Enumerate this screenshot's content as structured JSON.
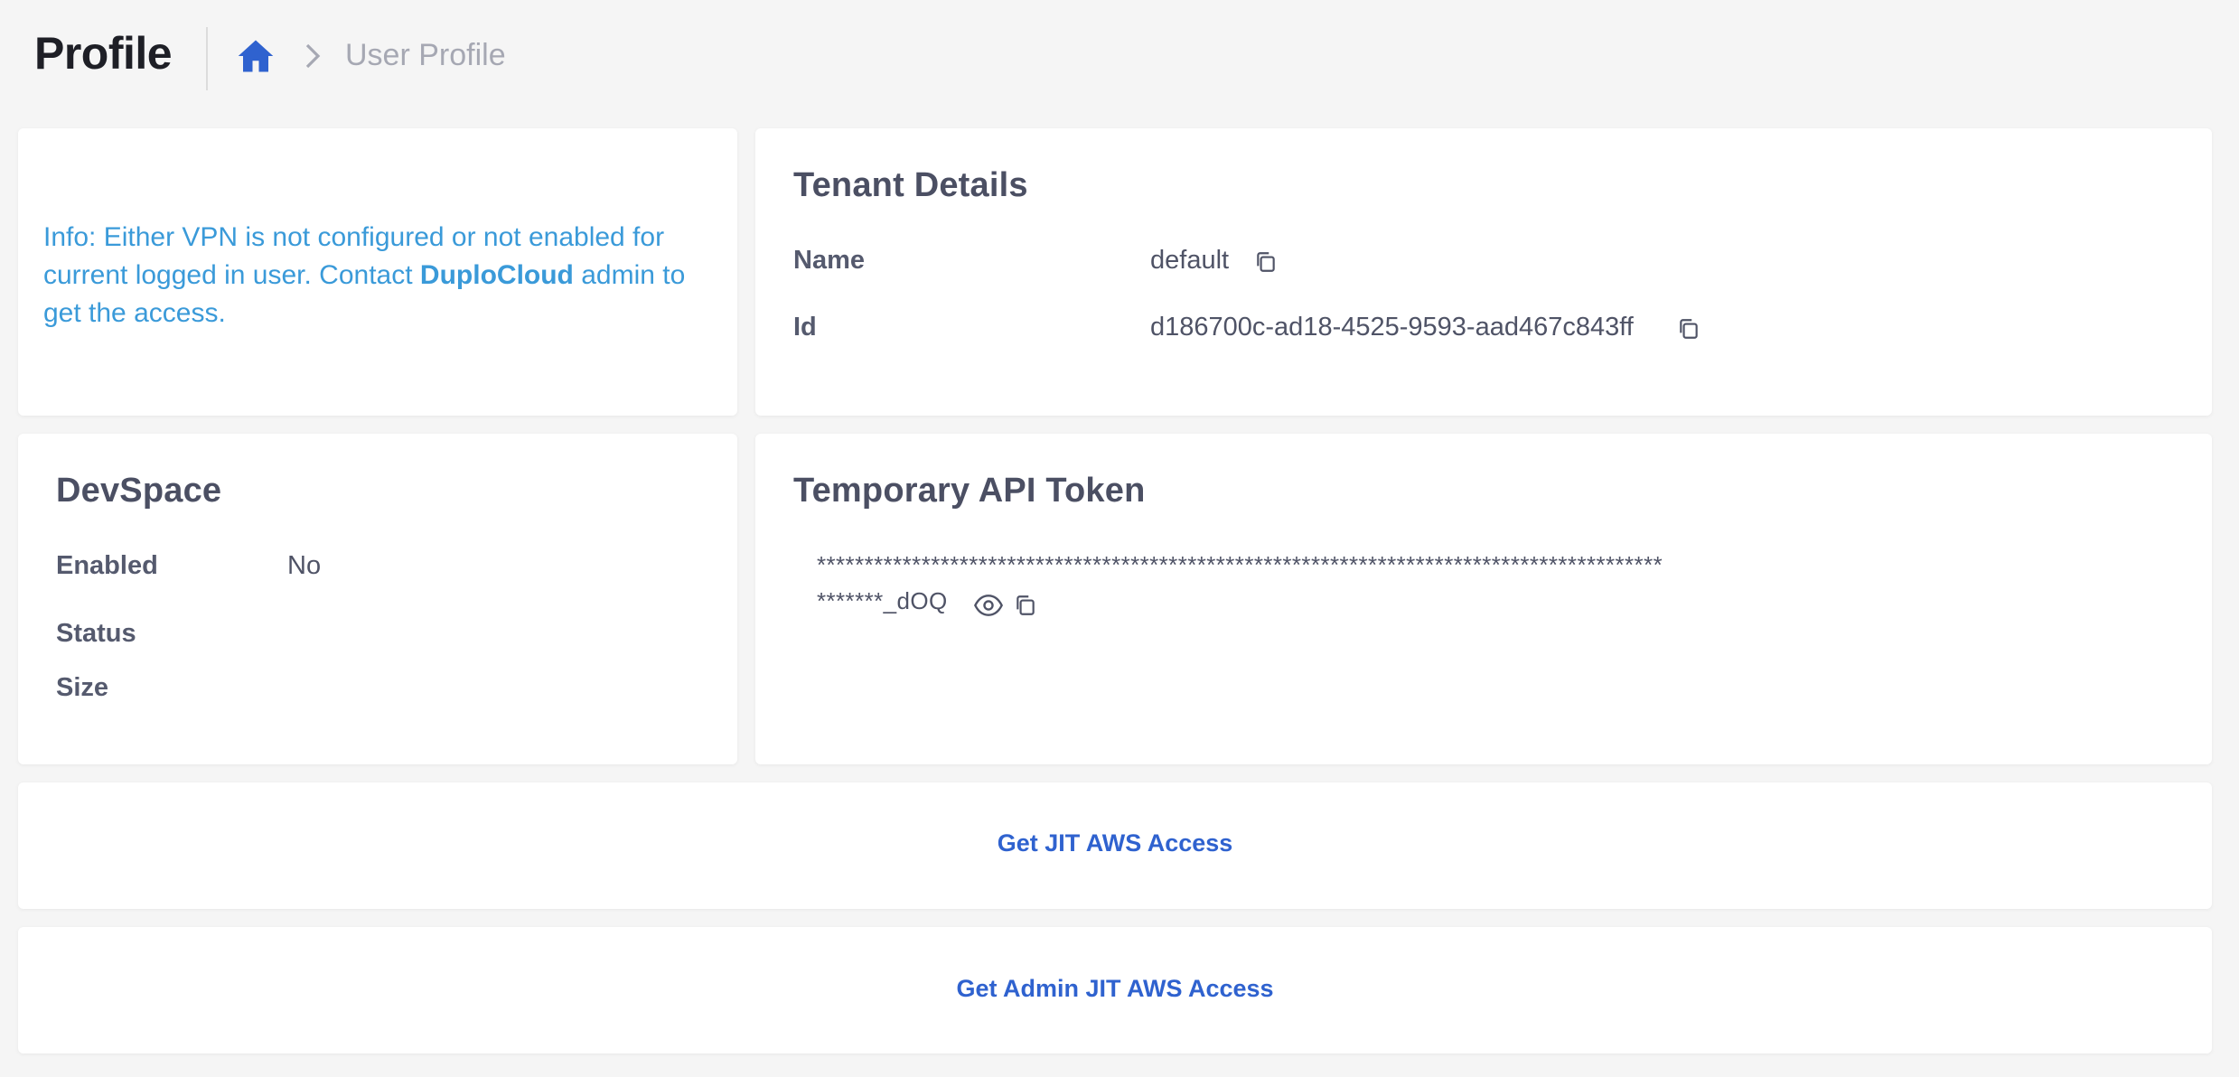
{
  "header": {
    "title": "Profile",
    "breadcrumb": {
      "home_icon": "home-icon",
      "separator_icon": "chevron-right-icon",
      "current": "User Profile"
    }
  },
  "vpn_info": {
    "text_before": "Info: Either VPN is not configured or not enabled for current logged in user. Contact ",
    "brand": "DuploCloud",
    "text_after": " admin to get the access."
  },
  "tenant_details": {
    "title": "Tenant Details",
    "rows": [
      {
        "label": "Name",
        "value": "default",
        "icon": "copy-icon"
      },
      {
        "label": "Id",
        "value": "d186700c-ad18-4525-9593-aad467c843ff",
        "icon": "copy-icon"
      }
    ]
  },
  "devspace": {
    "title": "DevSpace",
    "rows": [
      {
        "label": "Enabled",
        "value": "No"
      },
      {
        "label": "Status",
        "value": ""
      },
      {
        "label": "Size",
        "value": ""
      }
    ]
  },
  "api_token": {
    "title": "Temporary API Token",
    "masked_line1": "*****************************************************************************************",
    "masked_line2": "*******_dOQ",
    "reveal_icon": "eye-icon",
    "copy_icon": "copy-icon"
  },
  "actions": {
    "jit_label": "Get JIT AWS Access",
    "admin_jit_label": "Get Admin JIT AWS Access"
  },
  "colors": {
    "background": "#f5f5f5",
    "card": "#ffffff",
    "info_text": "#3a9ad9",
    "link": "#2f62cf",
    "home_icon": "#2f62cf"
  }
}
